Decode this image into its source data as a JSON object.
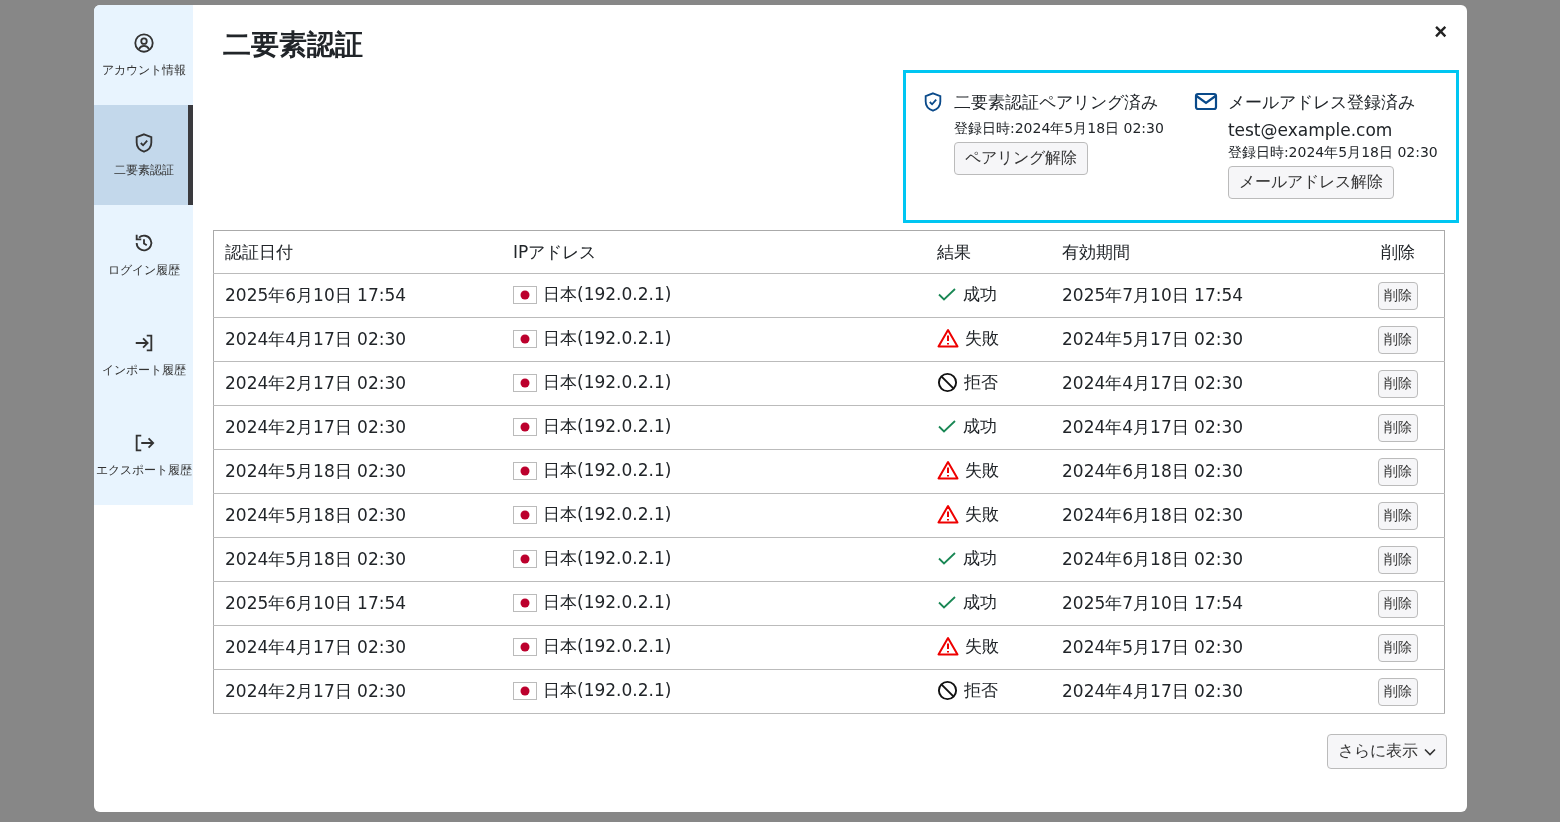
{
  "sidebar": {
    "items": [
      {
        "kind": "account",
        "label": "アカウント情報",
        "selected": false
      },
      {
        "kind": "shield",
        "label": "二要素認証",
        "selected": true
      },
      {
        "kind": "history",
        "label": "ログイン履歴",
        "selected": false
      },
      {
        "kind": "import",
        "label": "インポート履歴",
        "selected": false
      },
      {
        "kind": "export",
        "label": "エクスポート履歴",
        "selected": false
      }
    ]
  },
  "title": "二要素認証",
  "close": "×",
  "status": {
    "pairing": {
      "title": "二要素認証ペアリング済み",
      "registered": "登録日時:2024年5月18日 02:30",
      "button": "ペアリング解除"
    },
    "email": {
      "title": "メールアドレス登録済み",
      "address": "test@example.com",
      "registered": "登録日時:2024年5月18日 02:30",
      "button": "メールアドレス解除"
    }
  },
  "table": {
    "columns": [
      "認証日付",
      "IPアドレス",
      "結果",
      "有効期間",
      "削除"
    ],
    "rows": [
      {
        "date": "2025年6月10日 17:54",
        "ip": "日本(192.0.2.1)",
        "kind": "success",
        "result": "成功",
        "expiry": "2025年7月10日 17:54",
        "action": "削除"
      },
      {
        "date": "2024年4月17日 02:30",
        "ip": "日本(192.0.2.1)",
        "kind": "failure",
        "result": "失敗",
        "expiry": "2024年5月17日 02:30",
        "action": "削除"
      },
      {
        "date": "2024年2月17日 02:30",
        "ip": "日本(192.0.2.1)",
        "kind": "rejected",
        "result": "拒否",
        "expiry": "2024年4月17日 02:30",
        "action": "削除"
      },
      {
        "date": "2024年2月17日 02:30",
        "ip": "日本(192.0.2.1)",
        "kind": "success",
        "result": "成功",
        "expiry": "2024年4月17日 02:30",
        "action": "削除"
      },
      {
        "date": "2024年5月18日 02:30",
        "ip": "日本(192.0.2.1)",
        "kind": "failure",
        "result": "失敗",
        "expiry": "2024年6月18日 02:30",
        "action": "削除"
      },
      {
        "date": "2024年5月18日 02:30",
        "ip": "日本(192.0.2.1)",
        "kind": "failure",
        "result": "失敗",
        "expiry": "2024年6月18日 02:30",
        "action": "削除"
      },
      {
        "date": "2024年5月18日 02:30",
        "ip": "日本(192.0.2.1)",
        "kind": "success",
        "result": "成功",
        "expiry": "2024年6月18日 02:30",
        "action": "削除"
      },
      {
        "date": "2025年6月10日 17:54",
        "ip": "日本(192.0.2.1)",
        "kind": "success",
        "result": "成功",
        "expiry": "2025年7月10日 17:54",
        "action": "削除"
      },
      {
        "date": "2024年4月17日 02:30",
        "ip": "日本(192.0.2.1)",
        "kind": "failure",
        "result": "失敗",
        "expiry": "2024年5月17日 02:30",
        "action": "削除"
      },
      {
        "date": "2024年2月17日 02:30",
        "ip": "日本(192.0.2.1)",
        "kind": "rejected",
        "result": "拒否",
        "expiry": "2024年4月17日 02:30",
        "action": "削除"
      }
    ]
  },
  "show_more": "さらに表示"
}
